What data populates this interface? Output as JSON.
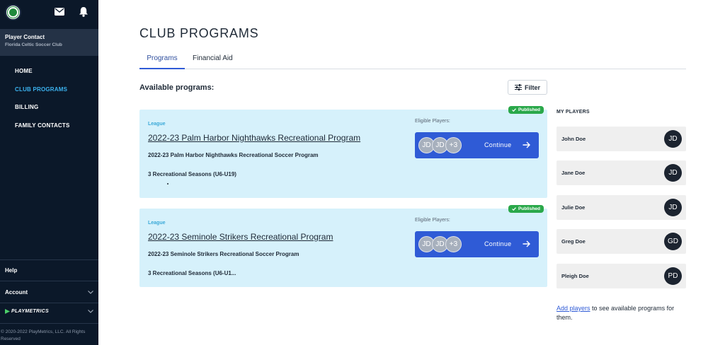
{
  "sidebar": {
    "contact_title": "Player Contact",
    "contact_subtitle": "Florida Celtic Soccer Club",
    "nav": [
      {
        "label": "HOME",
        "active": false
      },
      {
        "label": "CLUB PROGRAMS",
        "active": true
      },
      {
        "label": "BILLING",
        "active": false
      },
      {
        "label": "FAMILY CONTACTS",
        "active": false
      }
    ],
    "help_label": "Help",
    "account_label": "Account",
    "brand_label": "PLAYMETRICS",
    "copyright": "© 2020-2022 PlayMetrics, LLC. All Rights Reserved"
  },
  "page": {
    "title": "CLUB PROGRAMS",
    "tabs": [
      {
        "label": "Programs",
        "active": true
      },
      {
        "label": "Financial Aid",
        "active": false
      }
    ],
    "available_label": "Available programs:",
    "filter_label": "Filter"
  },
  "programs": [
    {
      "type": "League",
      "status": "Published",
      "title": "2022-23 Palm Harbor Nighthawks Recreational Program",
      "subtitle": "2022-23 Palm Harbor Nighthawks Recreational Soccer Program",
      "seasons": "3 Recreational Seasons (U6-U19)",
      "eligible_label": "Eligible Players:",
      "avatars": [
        "JD",
        "JD",
        "+3"
      ],
      "continue_label": "Continue"
    },
    {
      "type": "League",
      "status": "Published",
      "title": "2022-23 Seminole Strikers Recreational Program",
      "subtitle": "2022-23 Seminole Strikers Recreational Soccer Program",
      "seasons": "3 Recreational Seasons (U6-U1...",
      "eligible_label": "Eligible Players:",
      "avatars": [
        "JD",
        "JD",
        "+3"
      ],
      "continue_label": "Continue"
    }
  ],
  "my_players": {
    "title": "MY PLAYERS",
    "players": [
      {
        "name": "John Doe",
        "initials": "JD"
      },
      {
        "name": "Jane Doe",
        "initials": "JD"
      },
      {
        "name": "Julie Doe",
        "initials": "JD"
      },
      {
        "name": "Greg Doe",
        "initials": "GD"
      },
      {
        "name": "Pleigh Doe",
        "initials": "PD"
      }
    ],
    "add_link": "Add players",
    "add_suffix": " to see available programs for them."
  },
  "colors": {
    "sidebar_bg": "#0b1829",
    "nav_active": "#3bb3f0",
    "card_bg": "#d6f1fb",
    "primary": "#2f5bd6",
    "published": "#2aa84a"
  }
}
